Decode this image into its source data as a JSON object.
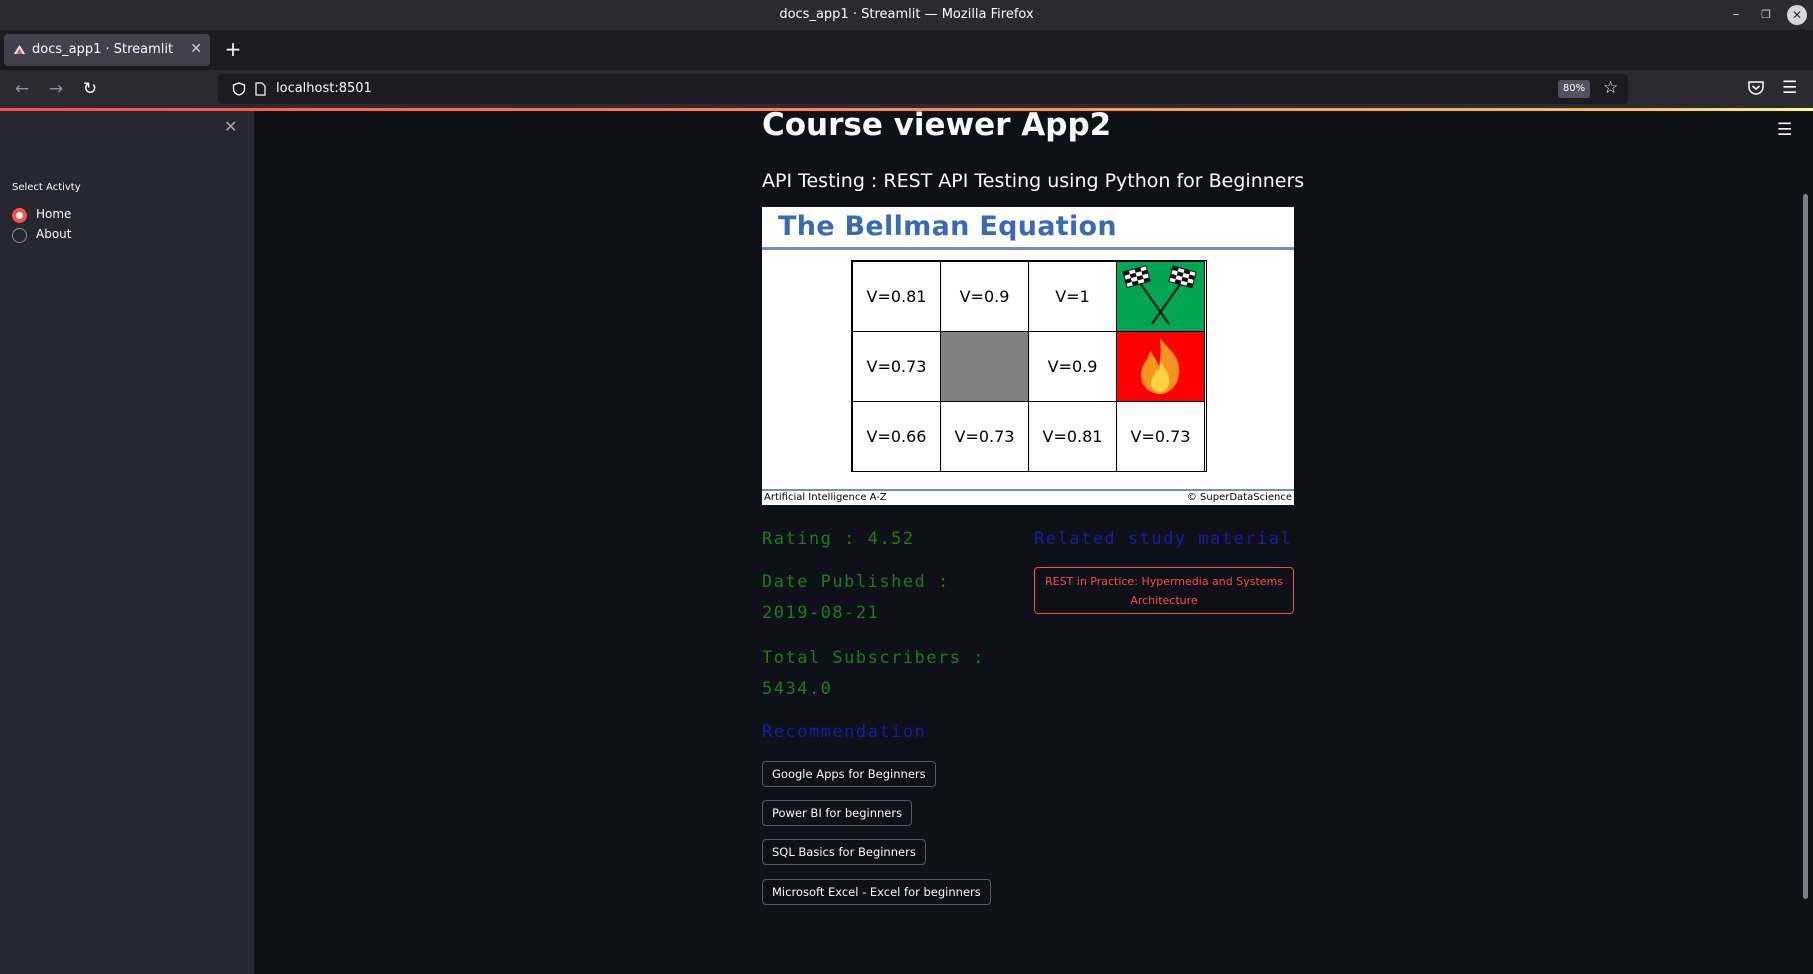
{
  "window": {
    "title": "docs_app1 · Streamlit — Mozilla Firefox"
  },
  "browser": {
    "tab_title": "docs_app1 · Streamlit",
    "url": "localhost:8501",
    "zoom": "80%"
  },
  "sidebar": {
    "radio_title": "Select Activty",
    "options": [
      {
        "label": "Home",
        "selected": true
      },
      {
        "label": "About",
        "selected": false
      }
    ]
  },
  "main": {
    "title": "Course viewer App2",
    "course_title": "API Testing : REST API Testing using Python for Beginners",
    "image": {
      "title": "The Bellman Equation",
      "grid": [
        [
          "V=0.81",
          "V=0.9",
          "V=1",
          ""
        ],
        [
          "V=0.73",
          "",
          "V=0.9",
          ""
        ],
        [
          "V=0.66",
          "V=0.73",
          "V=0.81",
          "V=0.73"
        ]
      ],
      "footer_left": "Artificial Intelligence A-Z",
      "footer_right": "© SuperDataScience"
    },
    "rating": "Rating : 4.52",
    "date_label": "Date Published :",
    "date_value": "2019-08-21",
    "subscribers_label": "Total Subscribers :",
    "subscribers_value": "5434.0",
    "related_heading": "Related study material",
    "related_button": "REST in Practice: Hypermedia and Systems Architecture",
    "recommendation_heading": "Recommendation",
    "recommendations": [
      "Google Apps for Beginners",
      "Power BI for beginners",
      "SQL Basics for Beginners",
      "Microsoft Excel - Excel for beginners"
    ]
  },
  "colors": {
    "accent": "#ff4b4b",
    "stat_green": "#1f7a1f",
    "heading_blue": "#1a1aa3",
    "background": "#0e1117",
    "sidebar": "#262730"
  }
}
